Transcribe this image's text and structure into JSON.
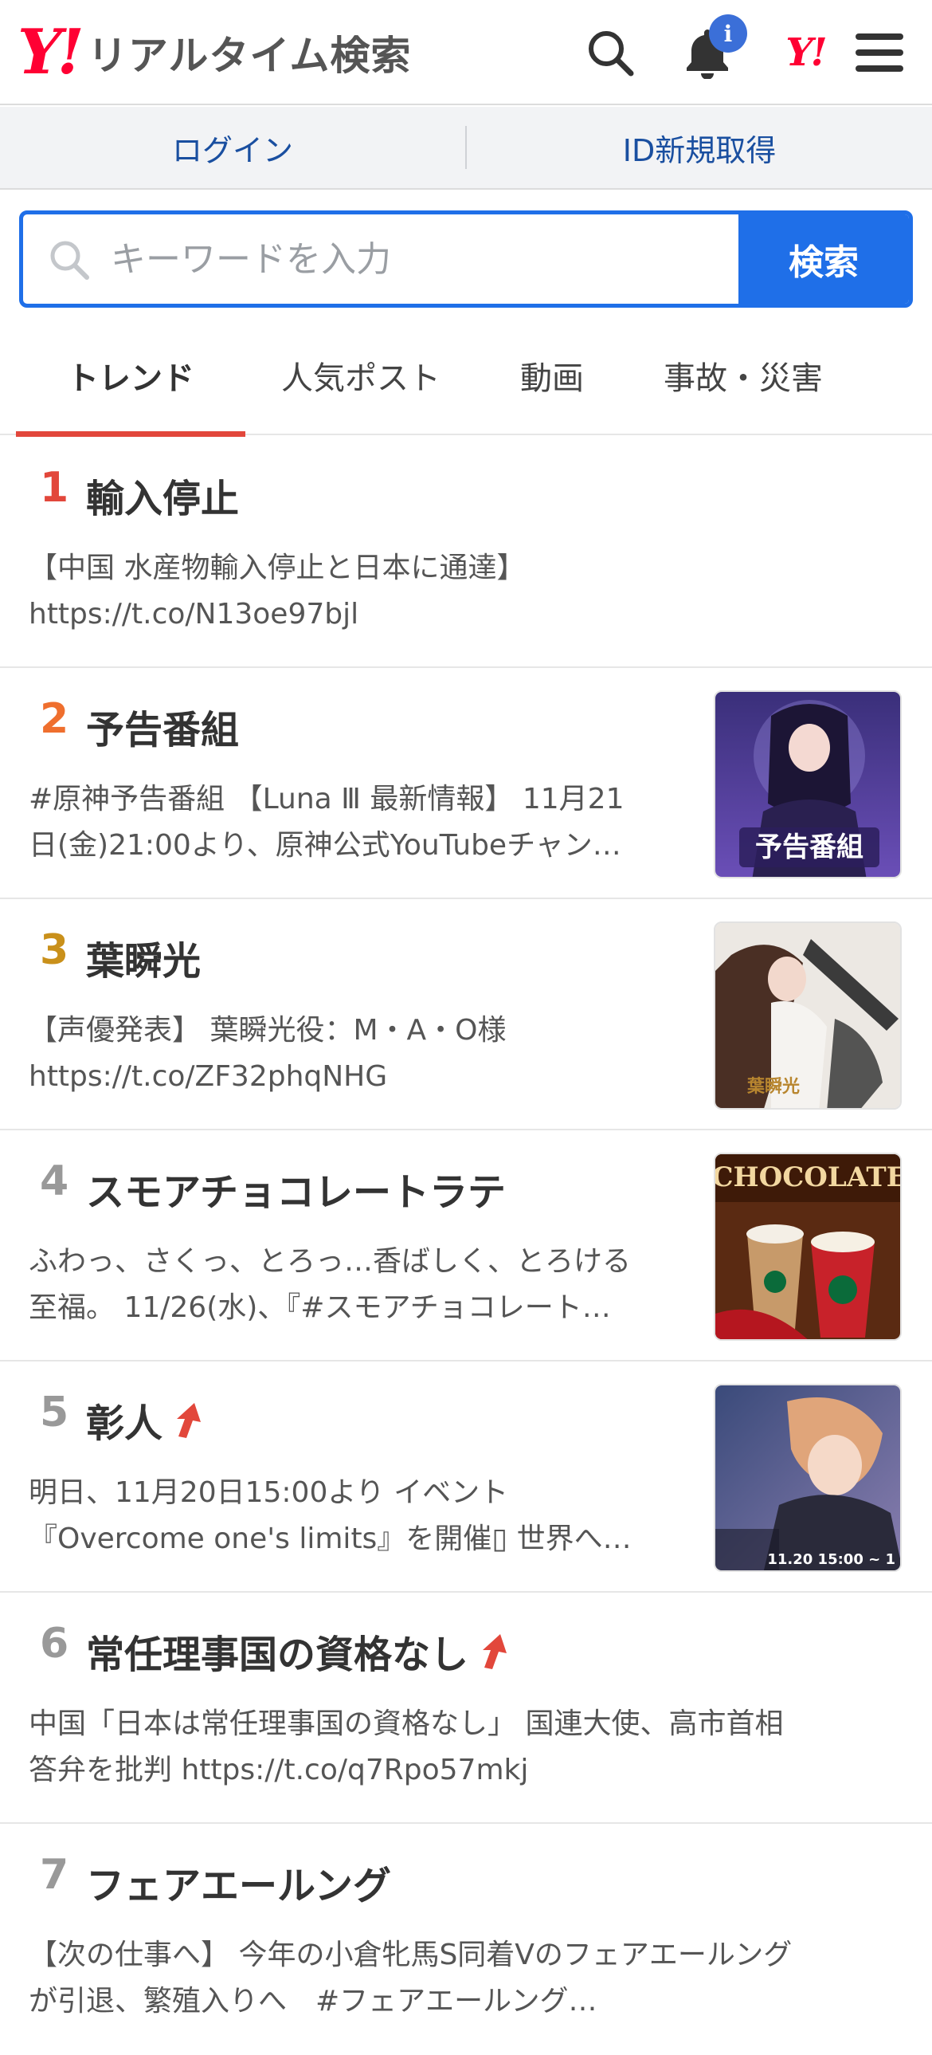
{
  "header": {
    "logo_mark": "Y!",
    "logo_text": "リアルタイム検索",
    "notification_badge": "i",
    "yahoo_small": "Y!"
  },
  "auth": {
    "login": "ログイン",
    "signup": "ID新規取得"
  },
  "search": {
    "placeholder": "キーワードを入力",
    "button": "検索"
  },
  "tabs": [
    {
      "label": "トレンド",
      "active": true
    },
    {
      "label": "人気ポスト"
    },
    {
      "label": "動画"
    },
    {
      "label": "事故・災害"
    }
  ],
  "colors": {
    "accent_blue": "#1f6fe8",
    "tab_underline": "#e2473b",
    "rank1": "#e2473b",
    "rank2": "#ef6f2e",
    "rank3": "#c9901a",
    "rank_other": "#999999"
  },
  "trends": [
    {
      "rank": "1",
      "title": "輸入停止",
      "line1": "【中国 水産物輸入停止と日本に通達】",
      "line2": "https://t.co/N13oe97bjl",
      "thumbnail": null,
      "rising": false
    },
    {
      "rank": "2",
      "title": "予告番組",
      "line1": "#原神予告番組 【Luna Ⅲ 最新情報】 11月21",
      "line2": "日(金)21:00より、原神公式YouTubeチャン…",
      "thumbnail": "anime-character-promo",
      "thumb_text": "予告番組",
      "rising": false
    },
    {
      "rank": "3",
      "title": "葉瞬光",
      "line1": "【声優発表】 葉瞬光役：M・A・O様",
      "line2": "https://t.co/ZF32phqNHG",
      "thumbnail": "anime-swordswoman",
      "thumb_text": "葉瞬光",
      "rising": false
    },
    {
      "rank": "4",
      "title": "スモアチョコレートラテ",
      "line1": "ふわっ、さくっ、とろっ…香ばしく、とろける",
      "line2": "至福。 11/26(水)、『#スモアチョコレート…",
      "thumbnail": "chocolate-drinks",
      "thumb_text": "CHOCOLATE",
      "rising": false
    },
    {
      "rank": "5",
      "title": "彰人",
      "line1": "明日、11月20日15:00より イベント",
      "line2": "『Overcome one's limits』を開催▯ 世界へ…",
      "thumbnail": "anime-singer",
      "thumb_text": "11.20 15:00 ~ 1",
      "rising": true
    },
    {
      "rank": "6",
      "title": "常任理事国の資格なし",
      "line1": "中国「日本は常任理事国の資格なし」 国連大使、高市首相",
      "line2": "答弁を批判 https://t.co/q7Rpo57mkj",
      "thumbnail": null,
      "rising": true
    },
    {
      "rank": "7",
      "title": "フェアエールング",
      "line1": "【次の仕事へ】 今年の小倉牝馬S同着Vのフェアエールング",
      "line2": "が引退、繁殖入りへ　#フェアエールング…",
      "thumbnail": null,
      "rising": false
    }
  ]
}
